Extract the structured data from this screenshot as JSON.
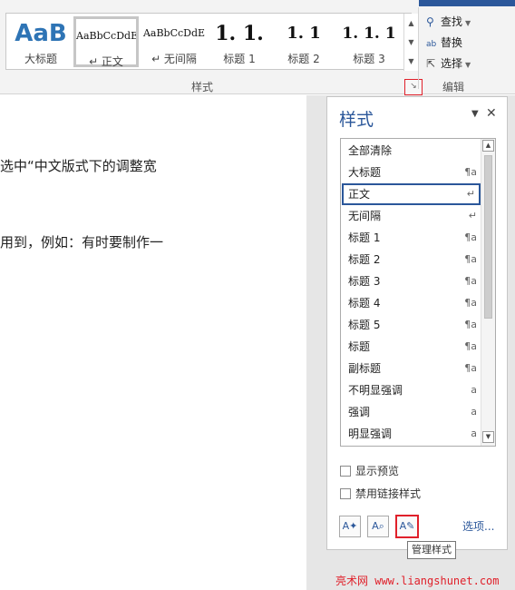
{
  "ribbon": {
    "gallery": [
      {
        "preview": "AaB",
        "name": "大标题"
      },
      {
        "preview": "AaBbCcDdE",
        "name": "↵ 正文"
      },
      {
        "preview": "AaBbCcDdE",
        "name": "↵ 无间隔"
      },
      {
        "preview": "1. 1.",
        "name": "标题 1"
      },
      {
        "preview": "1. 1",
        "name": "标题 2"
      },
      {
        "preview": "1. 1. 1",
        "name": "标题 3"
      }
    ],
    "styles_group_label": "样式",
    "editing_group_label": "编辑",
    "find_label": "查找",
    "replace_label": "替换",
    "select_label": "选择"
  },
  "document": {
    "lines": [
      "选中“中文版式下的调整宽",
      "用到，例如：有时要制作一"
    ]
  },
  "styles_pane": {
    "title": "样式",
    "items": [
      {
        "label": "全部清除",
        "marker": ""
      },
      {
        "label": "大标题",
        "marker": "¶a"
      },
      {
        "label": "正文",
        "marker": "↵"
      },
      {
        "label": "无间隔",
        "marker": "↵"
      },
      {
        "label": "标题 1",
        "marker": "¶a"
      },
      {
        "label": "标题 2",
        "marker": "¶a"
      },
      {
        "label": "标题 3",
        "marker": "¶a"
      },
      {
        "label": "标题 4",
        "marker": "¶a"
      },
      {
        "label": "标题 5",
        "marker": "¶a"
      },
      {
        "label": "标题",
        "marker": "¶a"
      },
      {
        "label": "副标题",
        "marker": "¶a"
      },
      {
        "label": "不明显强调",
        "marker": "a"
      },
      {
        "label": "强调",
        "marker": "a"
      },
      {
        "label": "明显强调",
        "marker": "a"
      }
    ],
    "show_preview_label": "显示预览",
    "disable_linked_label": "禁用链接样式",
    "options_link": "选项...",
    "manage_tooltip": "管理样式"
  },
  "watermark": "亮术网 www.liangshunet.com",
  "colors": {
    "accent": "#2b579a",
    "highlight": "#e0202a"
  }
}
